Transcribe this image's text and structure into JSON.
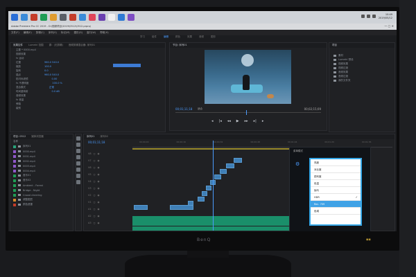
{
  "monitor": {
    "brand": "BenQ"
  },
  "taskbar": {
    "clock_time": "10:49",
    "clock_date": "2019/05/12",
    "icon_colors": [
      "#2a6ed6",
      "#3a8bd8",
      "#c43d2a",
      "#1f9d55",
      "#e09c2f",
      "#5a5f66",
      "#c43d2a",
      "#3a8bd8",
      "#e0455a",
      "#6a3fb0",
      "#f0f0f0",
      "#2f7bd4",
      "#7f4ec4"
    ]
  },
  "app": {
    "title": "Adobe Premiere Pro CC 2019 - D:\\视频项目\\2019\\0512\\0512.prproj",
    "menu": [
      "文件(F)",
      "编辑(E)",
      "剪辑(C)",
      "序列(S)",
      "标记(M)",
      "图形(G)",
      "窗口(W)",
      "帮助(H)"
    ],
    "workspaces": [
      "学习",
      "组件",
      "编辑",
      "颜色",
      "效果",
      "音频",
      "图形"
    ],
    "active_workspace": "编辑"
  },
  "effect_controls": {
    "tabs": [
      "效果控件",
      "Lumetri 范围",
      "源：(无剪辑)",
      "音频剪辑混合器: 序列01"
    ],
    "rows": [
      "主要 * 0000.mp4",
      "视频效果",
      "fx 运动",
      "位置",
      "缩放",
      "旋转",
      "锚点",
      "防闪烁滤镜",
      "fx 不透明度",
      "混合模式",
      "时间重映射",
      "音频效果",
      "fx 音量",
      "旁路",
      "级别"
    ],
    "values": [
      "960.0  540.0",
      "100.0",
      "0.0",
      "960.0  540.0",
      "0.00",
      "100.0 %",
      "正常",
      "0.0 dB"
    ]
  },
  "program_monitor": {
    "tab": "节目: 序列01",
    "timecode": "00;01;11;18",
    "fit": "适合",
    "duration": "00;02;15;09",
    "controls": [
      "◂",
      "|◂",
      "◂◂",
      "▶",
      "▸▸",
      "▸|",
      "▸"
    ]
  },
  "project_bin": {
    "tab": "项目",
    "items": [
      "素材",
      "Lumetri 预设",
      "视频效果",
      "视频过渡",
      "音频效果",
      "音频过渡",
      "我的文件夹"
    ]
  },
  "project_panel": {
    "tabs": [
      "项目: 0512",
      "媒体浏览器"
    ],
    "header": "名称",
    "rows": [
      "序列01",
      "0000.mp4",
      "0001.mp4",
      "0002.mp4",
      "0003.mp4",
      "0004.mp4",
      "音乐01",
      "音乐02",
      "Ambient - Forest",
      "Bridge - Night",
      "Crowd cheering",
      "调整图层",
      "颜色遮罩"
    ],
    "swatches": [
      "#2aa37a",
      "#8f58c9",
      "#8f58c9",
      "#8f58c9",
      "#8f58c9",
      "#8f58c9",
      "#1f9d55",
      "#1f9d55",
      "#1f9d55",
      "#1f9d55",
      "#1f9d55",
      "#d48a2a",
      "#c43d2a"
    ]
  },
  "timeline": {
    "tabs": [
      "序列01",
      "序列02"
    ],
    "timecode": "00;01;11;18",
    "ruler_ticks": [
      "00;00;00",
      "00;00;16",
      "00;00;32",
      "00;00;48",
      "00;01;04",
      "00;01;20",
      "00;01;36",
      "00;01;52",
      "00;02;08"
    ],
    "track_labels": [
      "V8",
      "V7",
      "V6",
      "V5",
      "V4",
      "V3",
      "V2",
      "V1",
      "A1",
      "A2",
      "A3"
    ]
  },
  "modal": {
    "title": "菜单模式",
    "items": [
      "亮度",
      "对比度",
      "锐利度",
      "色温",
      "伽马",
      "HDR",
      "Rec. 709",
      "色域"
    ],
    "checked_index": 5,
    "selected_index": 6,
    "nav_buttons": [
      "∧",
      "∨",
      "✓",
      "<",
      "✕"
    ]
  }
}
